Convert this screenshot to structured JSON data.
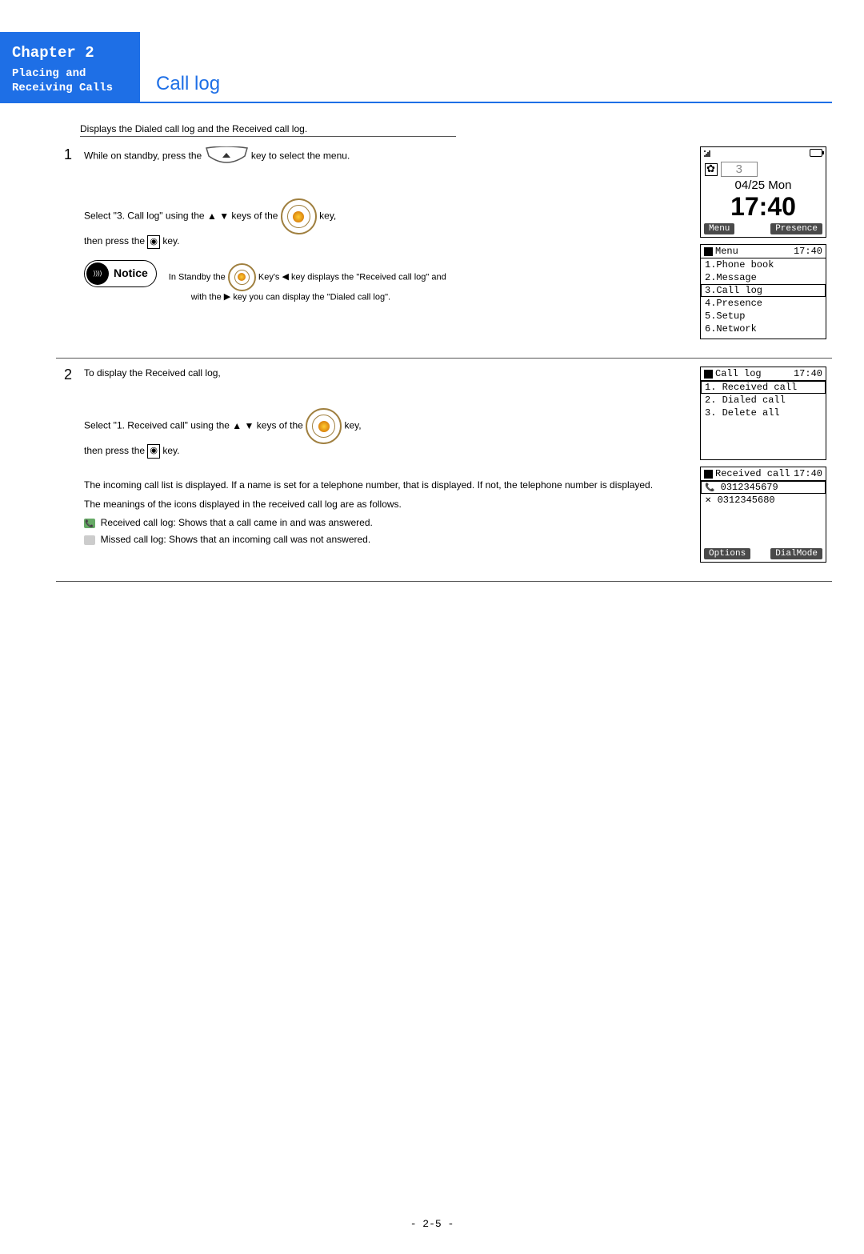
{
  "header": {
    "chapter": "Chapter 2",
    "subtitle": "Placing and Receiving Calls",
    "section": "Call log"
  },
  "intro": "Displays the Dialed call log and the Received call log.",
  "step1": {
    "num": "1",
    "line1a": "While on standby, press the",
    "line1b": "key to select the menu.",
    "line2a": "Select \"3. Call log\" using the",
    "line2b": "keys of the",
    "line2c": "key,",
    "line3a": "then press the",
    "line3b": "key.",
    "notice_label": "Notice",
    "notice_body1a": "In Standby the",
    "notice_body1b": "Key's",
    "notice_body1c": "key displays the \"Received call log\" and",
    "notice_body2a": "with the",
    "notice_body2b": "key you can display the \"Dialed call log\"."
  },
  "step2": {
    "num": "2",
    "line1": "To display the Received call log,",
    "line2a": "Select \"1. Received call\" using the",
    "line2b": "keys of the",
    "line2c": "key,",
    "line3a": "then press the",
    "line3b": "key.",
    "para2": "The incoming call list is displayed. If a name is set for a telephone number, that is displayed. If not, the telephone number is displayed.",
    "para3": "The meanings of the icons displayed in the received call log are as follows.",
    "bullet1": "Received call log:  Shows that a call came in and was answered.",
    "bullet2": "Missed call log:  Shows that an incoming call was not answered."
  },
  "screens": {
    "standby": {
      "badge": "3",
      "date": "04/25 Mon",
      "time": "17:40",
      "sk_left": "Menu",
      "sk_right": "Presence"
    },
    "menu": {
      "title": "Menu",
      "time": "17:40",
      "items": [
        "1.Phone book",
        "2.Message",
        "3.Call log",
        "4.Presence",
        "5.Setup",
        "6.Network"
      ]
    },
    "calllog": {
      "title": "Call log",
      "time": "17:40",
      "items": [
        "1. Received call",
        "2. Dialed call",
        "3. Delete all"
      ]
    },
    "received": {
      "title": "Received call",
      "time": "17:40",
      "rows": [
        "0312345679",
        "0312345680"
      ],
      "sk_left": "Options",
      "sk_right": "DialMode"
    }
  },
  "footer": "- 2-5 -"
}
